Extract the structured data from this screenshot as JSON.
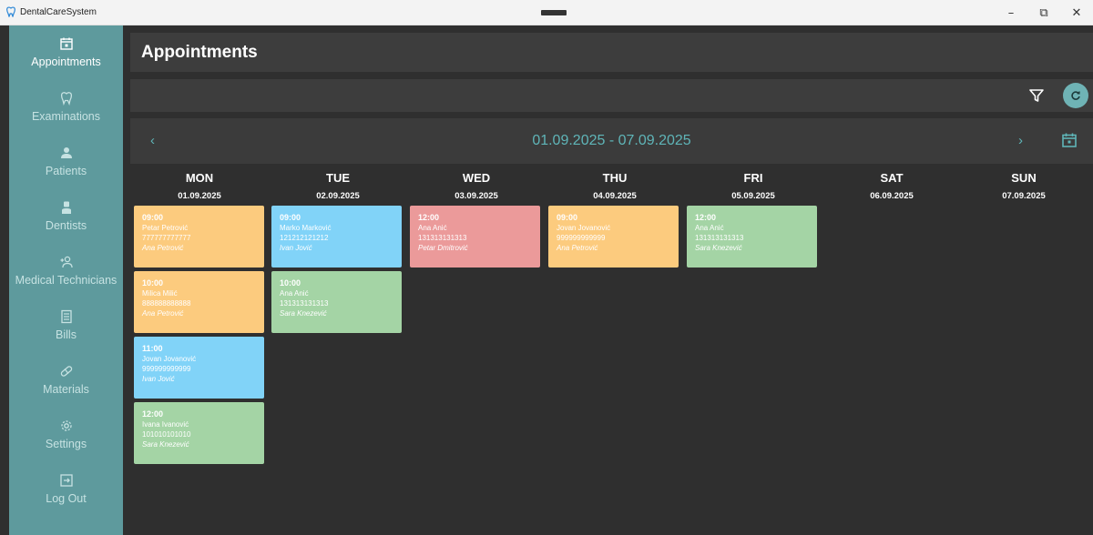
{
  "window": {
    "app_title": "DentalCareSystem",
    "controls": {
      "minimize": "–",
      "maximize": "⧉",
      "close": "✕"
    }
  },
  "sidebar": {
    "items": [
      {
        "label": "Appointments",
        "icon": "calendar-icon",
        "active": true
      },
      {
        "label": "Examinations",
        "icon": "tooth-icon",
        "active": false
      },
      {
        "label": "Patients",
        "icon": "person-icon",
        "active": false
      },
      {
        "label": "Dentists",
        "icon": "dentist-icon",
        "active": false
      },
      {
        "label": "Medical Technicians",
        "icon": "technician-icon",
        "active": false
      },
      {
        "label": "Bills",
        "icon": "bill-icon",
        "active": false
      },
      {
        "label": "Materials",
        "icon": "pill-icon",
        "active": false
      },
      {
        "label": "Settings",
        "icon": "gear-icon",
        "active": false
      },
      {
        "label": "Log Out",
        "icon": "logout-icon",
        "active": false
      }
    ]
  },
  "header": {
    "title": "Appointments"
  },
  "week": {
    "prev": "‹",
    "next": "›",
    "range": "01.09.2025 - 07.09.2025"
  },
  "days": [
    {
      "name": "MON",
      "date": "01.09.2025"
    },
    {
      "name": "TUE",
      "date": "02.09.2025"
    },
    {
      "name": "WED",
      "date": "03.09.2025"
    },
    {
      "name": "THU",
      "date": "04.09.2025"
    },
    {
      "name": "FRI",
      "date": "05.09.2025"
    },
    {
      "name": "SAT",
      "date": "06.09.2025"
    },
    {
      "name": "SUN",
      "date": "07.09.2025"
    }
  ],
  "appointments": {
    "mon": [
      {
        "time": "09:00",
        "patient": "Petar Petrović",
        "phone": "777777777777",
        "dentist": "Ana Petrović"
      },
      {
        "time": "10:00",
        "patient": "Milica Milić",
        "phone": "888888888888",
        "dentist": "Ana Petrović"
      },
      {
        "time": "11:00",
        "patient": "Jovan Jovanović",
        "phone": "999999999999",
        "dentist": "Ivan Jović"
      },
      {
        "time": "12:00",
        "patient": "Ivana Ivanović",
        "phone": "101010101010",
        "dentist": "Sara Knezević"
      }
    ],
    "tue": [
      {
        "time": "09:00",
        "patient": "Marko Marković",
        "phone": "121212121212",
        "dentist": "Ivan Jović"
      },
      {
        "time": "10:00",
        "patient": "Ana Anić",
        "phone": "131313131313",
        "dentist": "Sara Knezević"
      }
    ],
    "wed": [
      {
        "time": "12:00",
        "patient": "Ana Anić",
        "phone": "131313131313",
        "dentist": "Petar Dmitrović"
      }
    ],
    "thu": [
      {
        "time": "09:00",
        "patient": "Jovan Jovanović",
        "phone": "999999999999",
        "dentist": "Ana Petrović"
      }
    ],
    "fri": [
      {
        "time": "12:00",
        "patient": "Ana Anić",
        "phone": "131313131313",
        "dentist": "Sara Knezević"
      }
    ]
  },
  "colors": {
    "sidebar": "#5e9a9d",
    "accent": "#5fb5b8",
    "orange": "#fccb7e",
    "blue": "#81d3f8",
    "red": "#eb9a9a",
    "green": "#a4d4a5"
  }
}
